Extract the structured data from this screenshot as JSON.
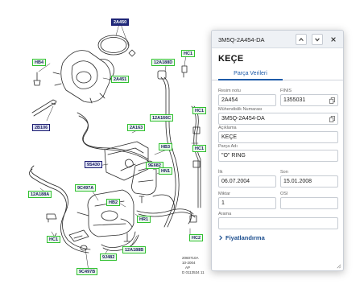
{
  "diagram": {
    "labels": {
      "top_selected": "2A450",
      "hb4": "HB4",
      "a2451": "2A451",
      "b2106": "2B106",
      "a12188d": "12A188D",
      "hc1_top": "HC1",
      "hc1_right": "HC1",
      "hc1_right2": "HC1",
      "a2163": "2A163",
      "a12166c": "12A166C",
      "hb3": "HB3",
      "s9430": "9S430",
      "e9682": "9E682",
      "hn1": "HN1",
      "a12188a": "12A188A",
      "a9c497": "9C497A",
      "hb2": "HB2",
      "hr1": "HR1",
      "hc1_bottom": "HC1",
      "hc2": "HC2",
      "j9482": "9J482",
      "b12188": "12A188B",
      "b9c497": "9C497B"
    },
    "meta_lines": [
      "2060710A",
      "10-2004",
      "AP",
      "D 0113534 11"
    ]
  },
  "panel": {
    "part_number": "3M5Q-2A454-DA",
    "title": "KEÇE",
    "tab_label": "Parça Verileri",
    "fields": {
      "resim_notu_label": "Resim notu",
      "resim_notu_value": "2A454",
      "finis_label": "FINIS",
      "finis_value": "1355031",
      "muh_label": "Mühendislik Numarası",
      "muh_value": "3M5Q-2A454-DA",
      "aciklama_label": "Açıklama",
      "aciklama_value": "KEÇE",
      "parca_adi_label": "Parça Adı",
      "parca_adi_value": "\"O\" RING",
      "ilk_label": "İlk",
      "ilk_value": "06.07.2004",
      "son_label": "Son",
      "son_value": "15.01.2008",
      "miktar_label": "Miktar",
      "miktar_value": "1",
      "osi_label": "OSI",
      "osi_value": "",
      "arama_label": "Arama",
      "arama_value": ""
    },
    "pricing_label": "Fiyatlandırma",
    "icons": [
      "chevron-up-icon",
      "chevron-down-icon",
      "close-icon",
      "copy-icon",
      "chevron-right-icon",
      "resize-icon"
    ]
  }
}
